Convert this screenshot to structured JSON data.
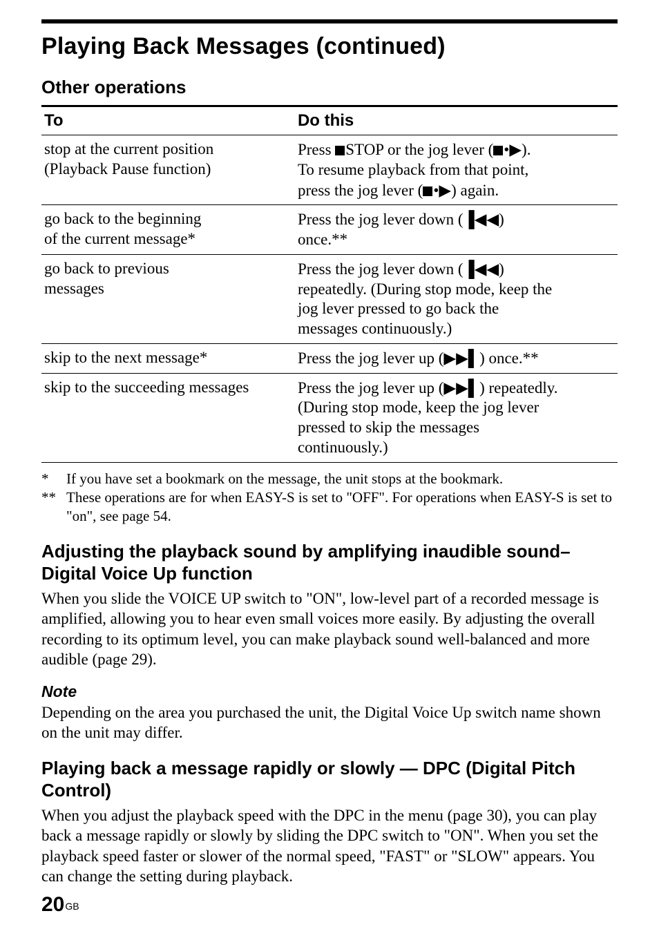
{
  "page": {
    "title": "Playing Back Messages (continued)",
    "section_other_ops": "Other operations",
    "table": {
      "head_to": "To",
      "head_do": "Do this",
      "rows": [
        {
          "to1": "stop at the current position",
          "to2": "(Playback Pause function)",
          "do1_a": "Press ",
          "do1_b": "STOP or the jog lever (",
          "do1_c": "•",
          "do1_d": ").",
          "do2": "To resume playback from that point,",
          "do3_a": "press the jog lever (",
          "do3_b": "•",
          "do3_c": ") again."
        },
        {
          "to1": "go back to the beginning",
          "to2": "of the current message*",
          "do1_a": "Press the jog lever down (",
          "do1_b": ")",
          "do2": "once.**"
        },
        {
          "to1": "go back to previous",
          "to2": "messages",
          "do1_a": "Press the jog lever down (",
          "do1_b": ")",
          "do2": "repeatedly. (During stop mode, keep the",
          "do3": "jog lever pressed to go back the",
          "do4": "messages continuously.)"
        },
        {
          "to1": "skip to the next  message*",
          "do1_a": "Press the jog lever up (",
          "do1_b": ") once.**"
        },
        {
          "to1": "skip to the succeeding messages",
          "do1_a": "Press the jog lever up (",
          "do1_b": ") repeatedly.",
          "do2": "(During stop mode, keep the jog lever",
          "do3": "pressed to skip the messages",
          "do4": "continuously.)"
        }
      ]
    },
    "footnote1_mark": "*",
    "footnote1_text": "If you have set a bookmark on the message, the unit stops at the bookmark.",
    "footnote2_mark": "**",
    "footnote2_text": "These operations are for when EASY-S is set to \"OFF\". For operations when EASY-S is set to \"on\", see page 54.",
    "sub1_title": "Adjusting the playback sound by amplifying inaudible sound–Digital Voice Up function",
    "sub1_body": "When you slide the VOICE UP switch to \"ON\", low-level part of a recorded message is amplified, allowing you to hear even small voices more easily.  By adjusting the overall recording to its optimum level, you can make playback sound well-balanced and more audible (page 29).",
    "note_label": "Note",
    "note_body": "Depending on the area you purchased the unit, the Digital Voice Up switch name shown on the unit  may differ.",
    "sub2_title": "Playing back a message rapidly or slowly — DPC (Digital Pitch Control)",
    "sub2_body": "When you  adjust the playback speed with the DPC in the menu (page 30), you can play back a message rapidly or slowly by sliding the DPC switch to \"ON\".   When you set the playback speed faster or slower of the normal speed, \"FAST\" or \"SLOW\" appears.  You can change the  setting during playback.",
    "page_number": "20",
    "page_region": "GB"
  },
  "icons": {
    "play": "▶",
    "prev": "▐◀◀",
    "next": "▶▶▌"
  }
}
